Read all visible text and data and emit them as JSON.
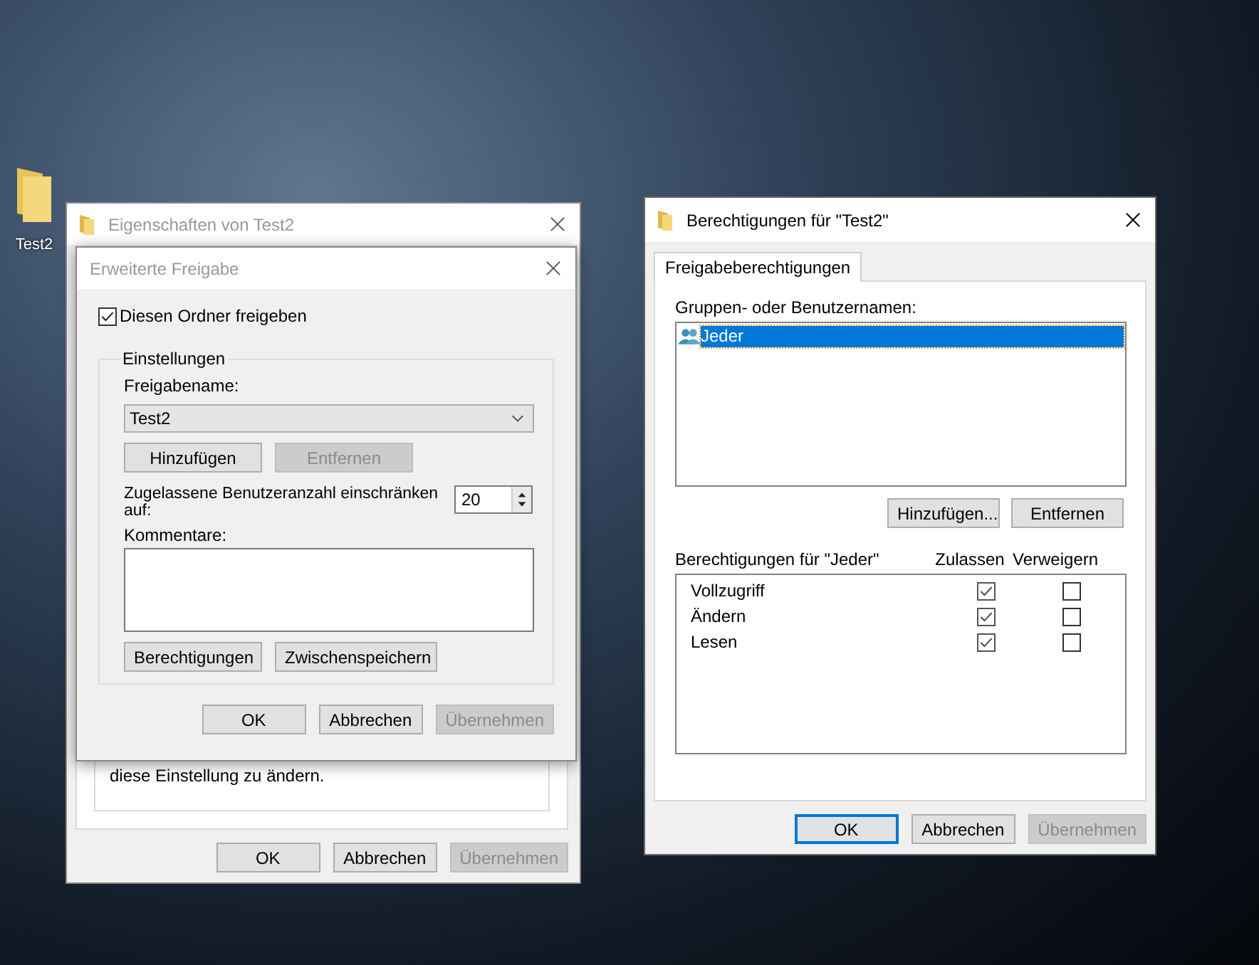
{
  "desktop": {
    "icons": [
      {
        "label": "Test2"
      }
    ]
  },
  "properties_window": {
    "title": "Eigenschaften von Test2",
    "active": false,
    "note": "diese Einstellung zu ändern.",
    "buttons": [
      {
        "label": "OK",
        "disabled": false
      },
      {
        "label": "Abbrechen",
        "disabled": false
      },
      {
        "label": "Übernehmen",
        "disabled": true
      }
    ]
  },
  "advanced_sharing_dialog": {
    "title": "Erweiterte Freigabe",
    "active": false,
    "share_checkbox": {
      "label": "Diesen Ordner freigeben",
      "checked": true
    },
    "settings": {
      "title": "Einstellungen",
      "share_name_label": "Freigabename:",
      "share_name": "Test2",
      "share_name_buttons": [
        {
          "label": "Hinzufügen",
          "disabled": false
        },
        {
          "label": "Entfernen",
          "disabled": true
        }
      ],
      "user_limit_label": "Zugelassene Benutzeranzahl einschränken auf:",
      "user_limit": "20",
      "comments_label": "Kommentare:",
      "buttons": [
        {
          "label": "Berechtigungen",
          "disabled": false
        },
        {
          "label": "Zwischenspeichern",
          "disabled": false
        }
      ]
    },
    "buttons": [
      {
        "label": "OK",
        "disabled": false
      },
      {
        "label": "Abbrechen",
        "disabled": false
      },
      {
        "label": "Übernehmen",
        "disabled": true
      }
    ]
  },
  "permissions_window": {
    "title": "Berechtigungen für \"Test2\"",
    "active": true,
    "tabs": [
      {
        "label": "Freigabeberechtigungen",
        "selected": true
      }
    ],
    "users_label": "Gruppen- oder Benutzernamen:",
    "users": [
      {
        "name": "Jeder",
        "selected": true
      }
    ],
    "user_buttons": [
      {
        "label": "Hinzufügen...",
        "disabled": false
      },
      {
        "label": "Entfernen",
        "disabled": false
      }
    ],
    "permissions_label": "Berechtigungen für \"Jeder\"",
    "columns": [
      "Zulassen",
      "Verweigern"
    ],
    "permissions": [
      {
        "name": "Vollzugriff",
        "allow": true,
        "deny": false
      },
      {
        "name": "Ändern",
        "allow": true,
        "deny": false
      },
      {
        "name": "Lesen",
        "allow": true,
        "deny": false
      }
    ],
    "buttons": [
      {
        "label": "OK",
        "disabled": false,
        "default": true
      },
      {
        "label": "Abbrechen",
        "disabled": false,
        "default": false
      },
      {
        "label": "Übernehmen",
        "disabled": true,
        "default": false
      }
    ]
  }
}
